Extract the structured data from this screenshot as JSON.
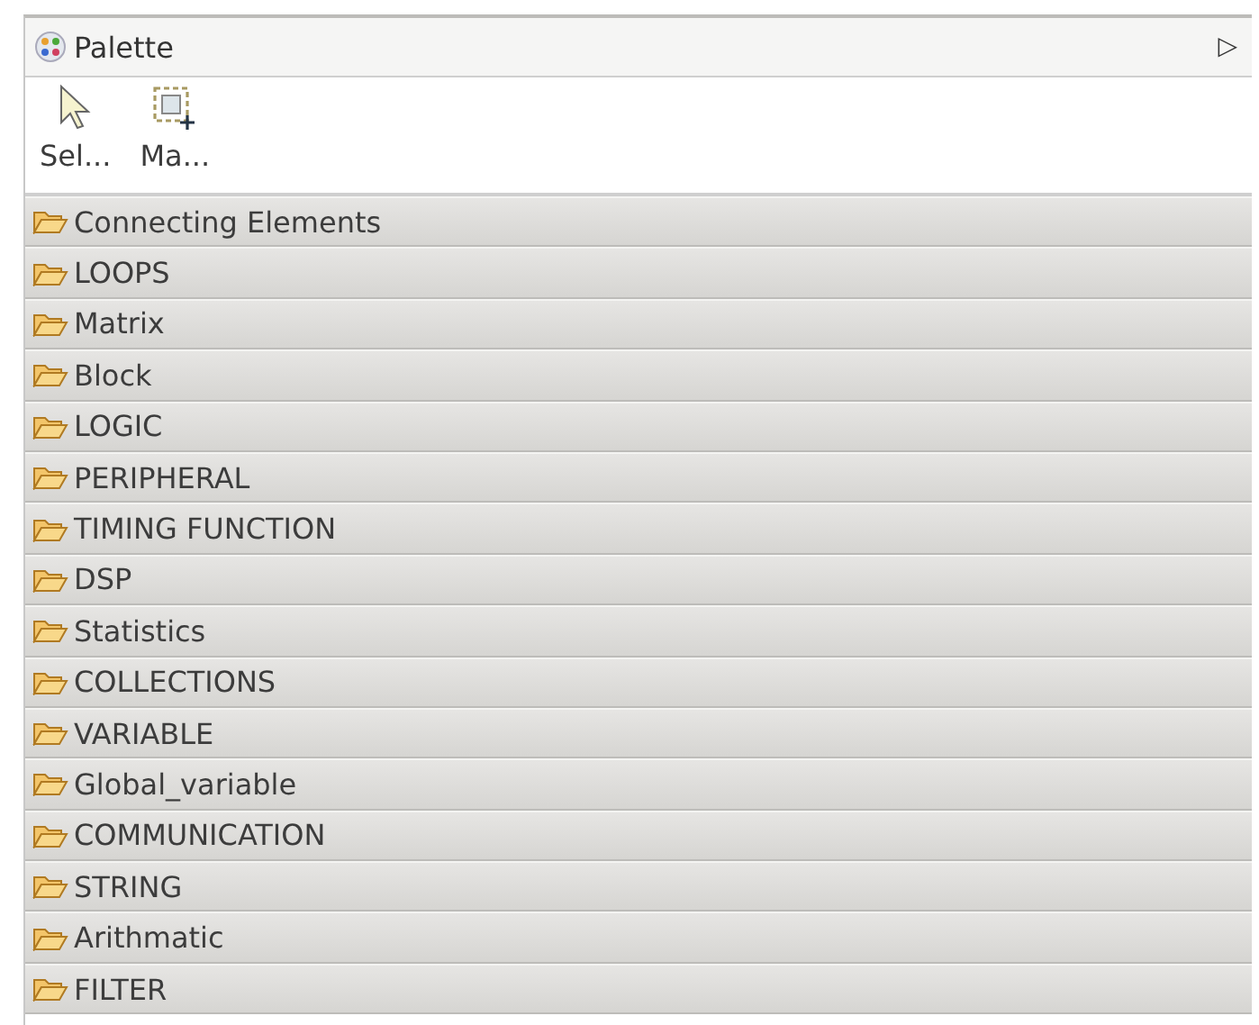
{
  "palette": {
    "title": "Palette",
    "collapse_glyph": "▷"
  },
  "tools": [
    {
      "label": "Sel...",
      "kind": "select"
    },
    {
      "label": "Ma...",
      "kind": "marquee"
    }
  ],
  "drawers": [
    {
      "label": "Connecting Elements"
    },
    {
      "label": "LOOPS"
    },
    {
      "label": "Matrix"
    },
    {
      "label": "Block"
    },
    {
      "label": "LOGIC"
    },
    {
      "label": "PERIPHERAL"
    },
    {
      "label": "TIMING FUNCTION"
    },
    {
      "label": "DSP"
    },
    {
      "label": "Statistics"
    },
    {
      "label": "COLLECTIONS"
    },
    {
      "label": "VARIABLE"
    },
    {
      "label": "Global_variable"
    },
    {
      "label": "COMMUNICATION"
    },
    {
      "label": "STRING"
    },
    {
      "label": "Arithmatic"
    },
    {
      "label": "FILTER"
    }
  ]
}
